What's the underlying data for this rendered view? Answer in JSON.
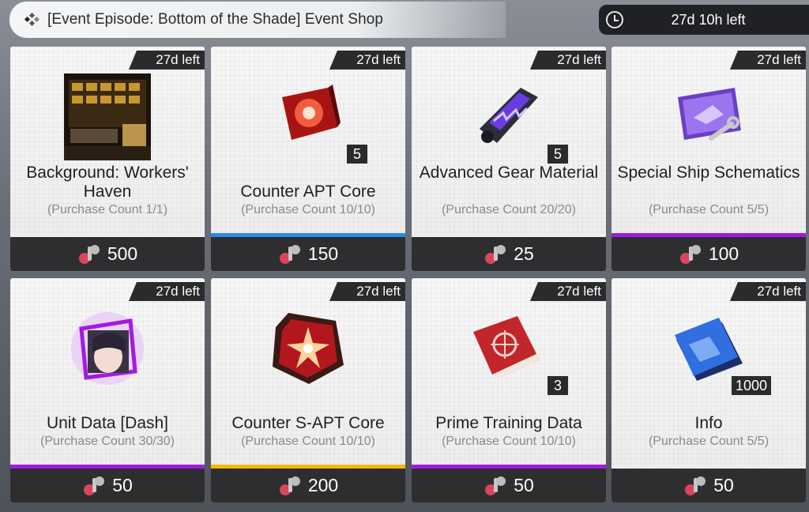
{
  "header": {
    "title": "[Event Episode: Bottom of the Shade] Event Shop",
    "timer": "27d 10h left"
  },
  "items": [
    {
      "time_left": "27d left",
      "name": "Background: Workers' Haven",
      "count": "(Purchase Count 1/1)",
      "qty": "",
      "price": "500",
      "rarity": "none",
      "icon": "workers-haven-background-icon"
    },
    {
      "time_left": "27d left",
      "name": "Counter APT Core",
      "count": "(Purchase Count 10/10)",
      "qty": "5",
      "price": "150",
      "rarity": "#2b8be0",
      "icon": "apt-core-icon"
    },
    {
      "time_left": "27d left",
      "name": "Advanced Gear Material",
      "count": "(Purchase Count 20/20)",
      "qty": "5",
      "price": "25",
      "rarity": "none",
      "icon": "gear-material-icon"
    },
    {
      "time_left": "27d left",
      "name": "Special Ship Schematics",
      "count": "(Purchase Count 5/5)",
      "qty": "",
      "price": "100",
      "rarity": "#a21be0",
      "icon": "ship-schematics-icon"
    },
    {
      "time_left": "27d left",
      "name": "Unit Data [Dash]",
      "count": "(Purchase Count 30/30)",
      "qty": "",
      "price": "50",
      "rarity": "#a21be0",
      "icon": "unit-data-dash-icon"
    },
    {
      "time_left": "27d left",
      "name": "Counter S-APT Core",
      "count": "(Purchase Count 10/10)",
      "qty": "",
      "price": "200",
      "rarity": "#f2b80c",
      "icon": "s-apt-core-icon"
    },
    {
      "time_left": "27d left",
      "name": "Prime Training Data",
      "count": "(Purchase Count 10/10)",
      "qty": "3",
      "price": "50",
      "rarity": "#a21be0",
      "icon": "training-data-book-icon"
    },
    {
      "time_left": "27d left",
      "name": "Info",
      "count": "(Purchase Count 5/5)",
      "qty": "1000",
      "price": "50",
      "rarity": "none",
      "icon": "info-book-icon"
    }
  ]
}
